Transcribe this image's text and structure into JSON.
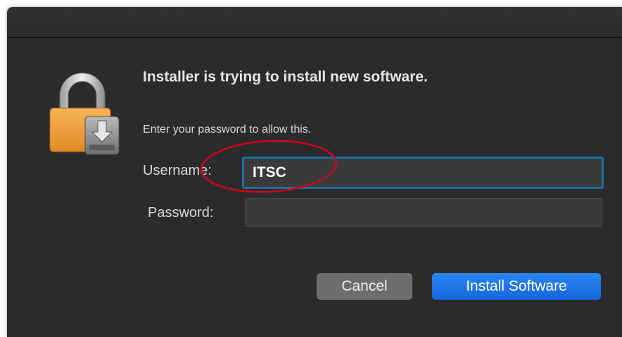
{
  "dialog": {
    "heading": "Installer is trying to install new software.",
    "subtext": "Enter your password to allow this.",
    "username_label": "Username:",
    "username_value": "ITSC",
    "password_label": "Password:",
    "password_value": "",
    "cancel_label": "Cancel",
    "install_label": "Install Software"
  },
  "colors": {
    "window_background": "#2b2b2d",
    "focus_ring": "#1c6f9e",
    "primary_button": "#1b74e4",
    "secondary_button": "#6d6d70",
    "annotation": "#d0021b"
  },
  "icons": {
    "dialog_icon": "padlock-with-installer-disk-icon"
  }
}
